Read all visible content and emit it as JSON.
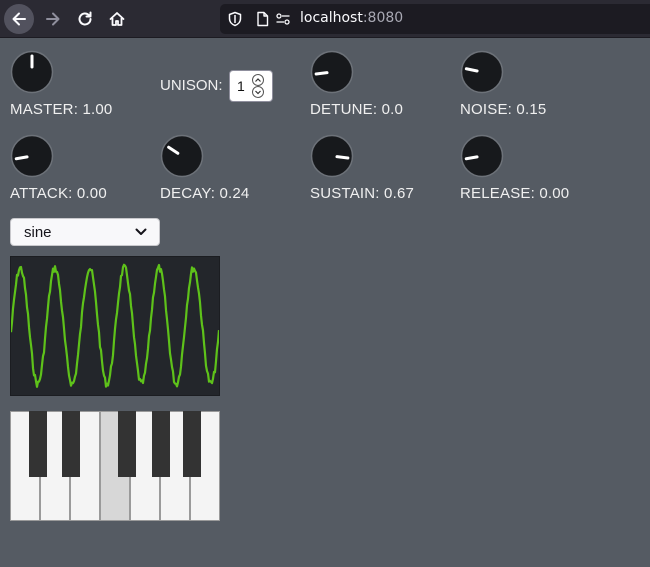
{
  "browser": {
    "url_host": "localhost",
    "url_port": ":8080"
  },
  "knobs": [
    {
      "id": "master",
      "label": "MASTER: 1.00",
      "level": 0.5
    },
    {
      "id": "detune",
      "label": "DETUNE: 0.0",
      "level": 0.14
    },
    {
      "id": "noise",
      "label": "NOISE: 0.15",
      "level": 0.21
    },
    {
      "id": "attack",
      "label": "ATTACK: 0.00",
      "level": 0.13
    },
    {
      "id": "decay",
      "label": "DECAY: 0.24",
      "level": 0.29
    },
    {
      "id": "sustain",
      "label": "SUSTAIN: 0.67",
      "level": 0.86
    },
    {
      "id": "release",
      "label": "RELEASE: 0.00",
      "level": 0.13
    }
  ],
  "unison": {
    "label": "UNISON:",
    "value": "1"
  },
  "waveform": {
    "selected": "sine"
  },
  "scope": {
    "wave_color": "#5ec21a",
    "cycles": 6
  },
  "keyboard": {
    "pressed_white_key": 3
  }
}
